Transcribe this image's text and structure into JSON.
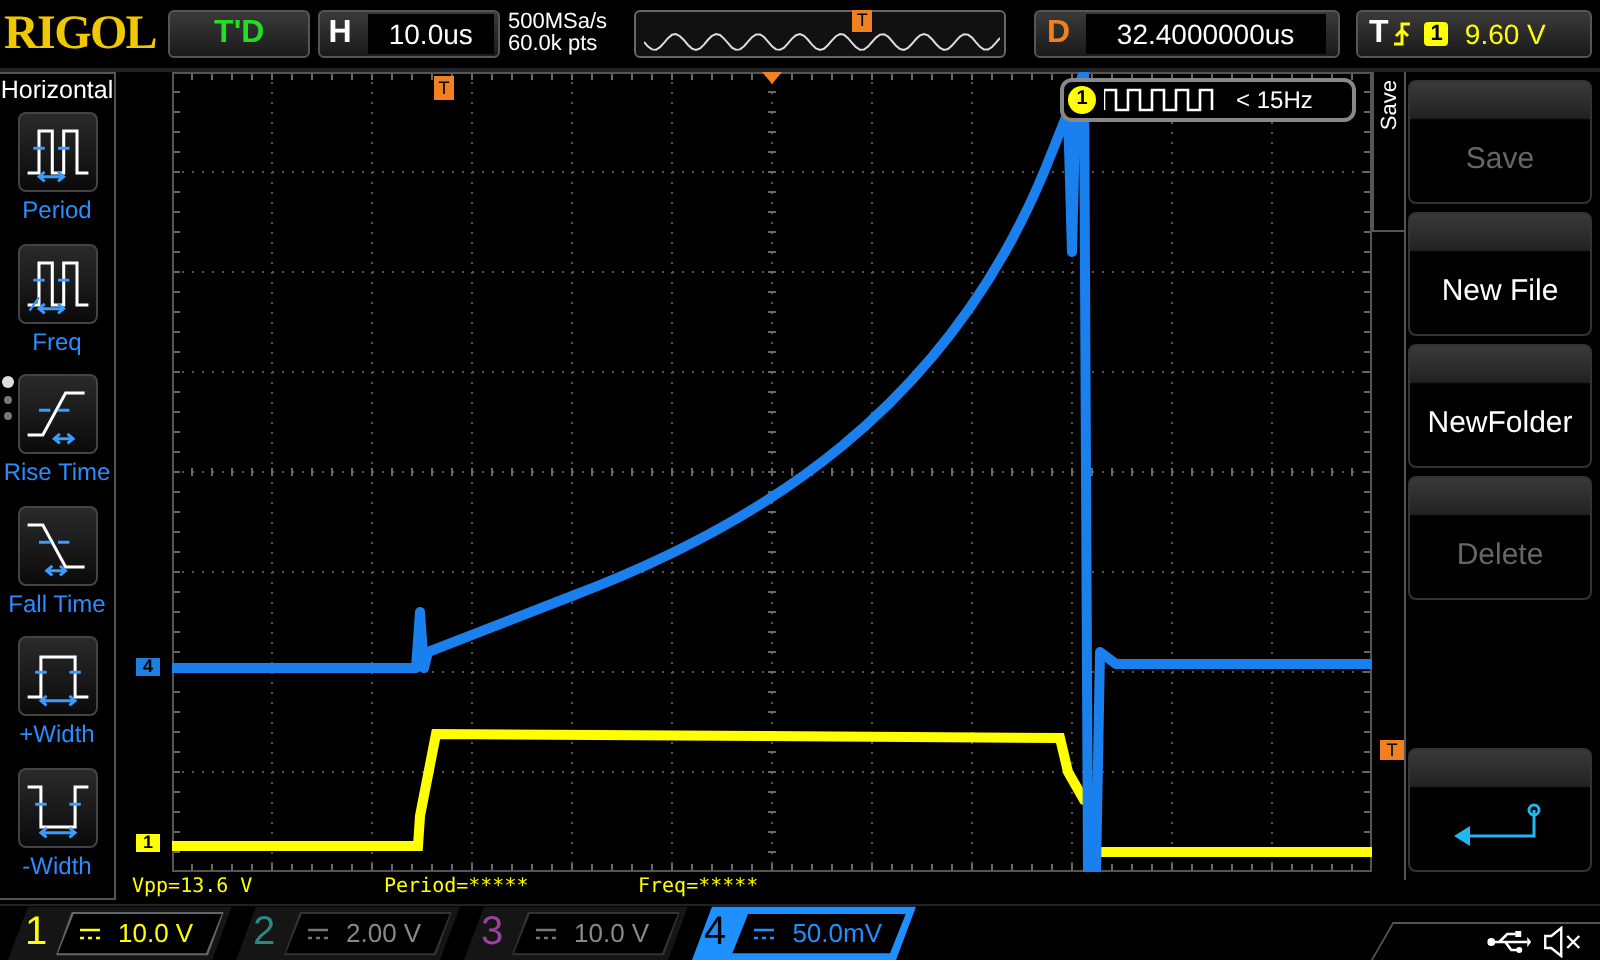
{
  "header": {
    "logo": "RIGOL",
    "run_status": "T'D",
    "horizontal": {
      "label": "H",
      "timebase": "10.0us"
    },
    "sample_rate": "500MSa/s",
    "memory_depth": "60.0k pts",
    "overview_marker": "T",
    "delay": {
      "label": "D",
      "value": "32.4000000us"
    },
    "trigger": {
      "label": "T",
      "channel": "1",
      "level": "9.60 V"
    }
  },
  "left_menu": {
    "title": "Horizontal",
    "items": [
      {
        "kind": "period",
        "label": "Period"
      },
      {
        "kind": "freq",
        "label": "Freq"
      },
      {
        "kind": "rise",
        "label": "Rise Time"
      },
      {
        "kind": "fall",
        "label": "Fall Time"
      },
      {
        "kind": "pwidth",
        "label": "+Width"
      },
      {
        "kind": "nwidth",
        "label": "-Width"
      }
    ]
  },
  "screen": {
    "trigger_position": "T",
    "channel_markers": [
      {
        "label": "4",
        "color": "#1e7fe0"
      },
      {
        "label": "1",
        "color": "#ffff00"
      }
    ],
    "trigger_level": "T",
    "counter": {
      "channel": "1",
      "reading": "< 15Hz"
    }
  },
  "measurements": [
    "Vpp=13.6 V",
    "Period=*****",
    "Freq=*****"
  ],
  "right_menu": {
    "title": "Save",
    "buttons": [
      {
        "label": "Save",
        "disabled": true
      },
      {
        "label": "New File",
        "disabled": false
      },
      {
        "label": "NewFolder",
        "disabled": false
      },
      {
        "label": "Delete",
        "disabled": true
      }
    ]
  },
  "channels": [
    {
      "number": "1",
      "scale": "10.0 V",
      "on": true,
      "selected": false,
      "color": "#ffff00"
    },
    {
      "number": "2",
      "scale": "2.00 V",
      "on": false,
      "selected": false,
      "color": "#2a8a80"
    },
    {
      "number": "3",
      "scale": "10.0 V",
      "on": false,
      "selected": false,
      "color": "#9a40a0"
    },
    {
      "number": "4",
      "scale": "50.0mV",
      "on": true,
      "selected": true,
      "color": "#1e90ff"
    }
  ]
}
